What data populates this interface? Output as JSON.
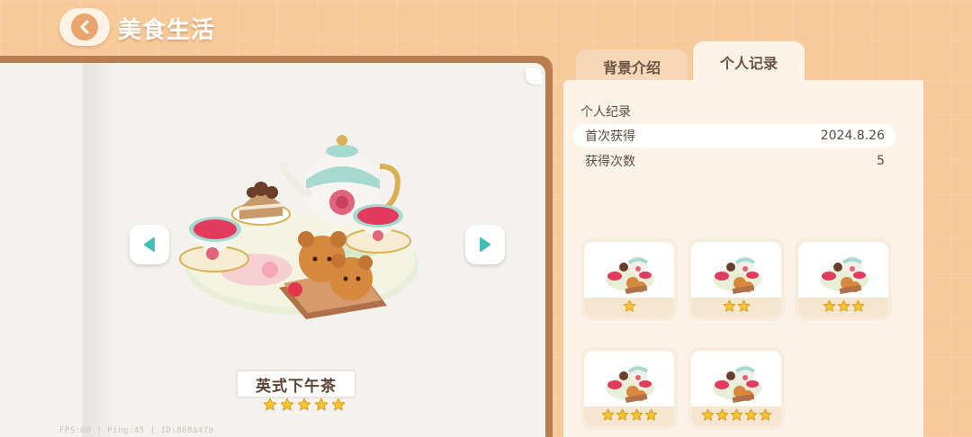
{
  "header": {
    "title": "美食生活",
    "back_icon": "chevron-left-icon"
  },
  "book": {
    "item_name": "英式下午茶",
    "rating": 5,
    "prev_icon": "triangle-left-icon",
    "next_icon": "triangle-right-icon",
    "debug_text": "FPS:60 | Ping:45 | ID:868a47b"
  },
  "tabs": [
    {
      "label": "背景介绍",
      "active": false
    },
    {
      "label": "个人记录",
      "active": true
    }
  ],
  "record": {
    "title": "个人纪录",
    "rows": [
      {
        "label": "首次获得",
        "value": "2024.8.26"
      },
      {
        "label": "获得次数",
        "value": "5"
      }
    ]
  },
  "variants": [
    {
      "stars": 1
    },
    {
      "stars": 2
    },
    {
      "stars": 3
    },
    {
      "stars": 4
    },
    {
      "stars": 5
    }
  ],
  "colors": {
    "background": "#f8c99a",
    "accent": "#e9a56e",
    "teal": "#3fbfb5",
    "star": "#f7c530",
    "text": "#5b4a3e"
  }
}
